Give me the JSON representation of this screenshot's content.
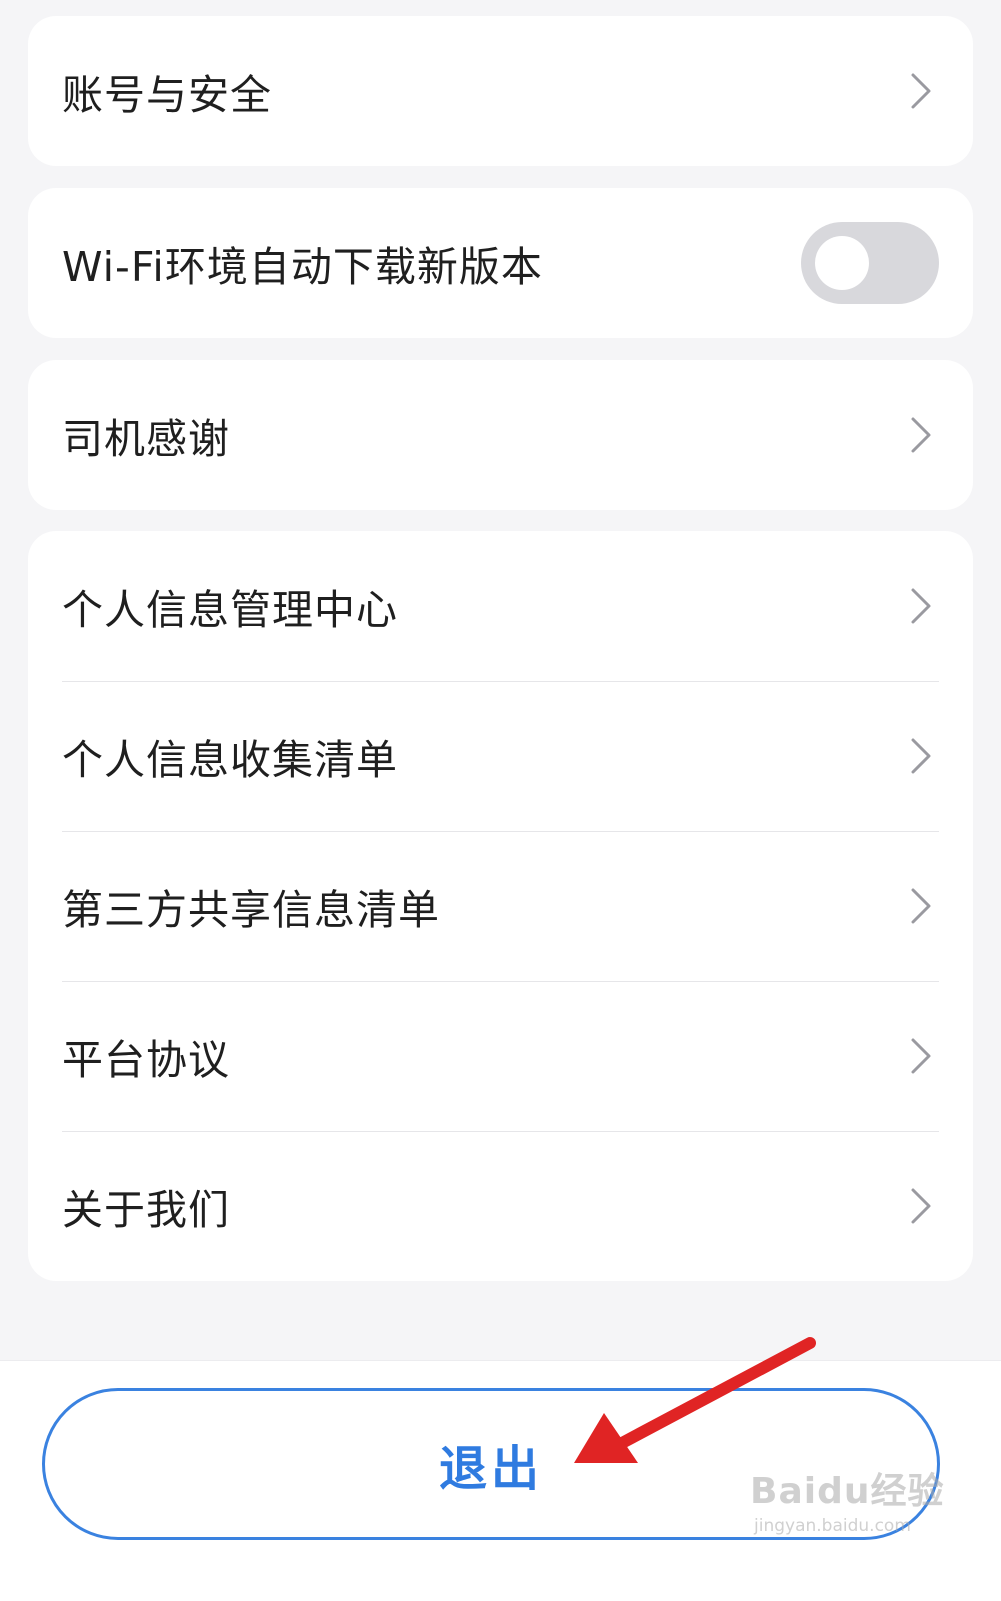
{
  "settings": {
    "group1": [
      {
        "label": "账号与安全",
        "icon": "chevron-right-icon"
      }
    ],
    "group2": [
      {
        "label": "Wi-Fi环境自动下载新版本",
        "toggle_on": false
      }
    ],
    "group3": [
      {
        "label": "司机感谢",
        "icon": "chevron-right-icon"
      }
    ],
    "group4": [
      {
        "label": "个人信息管理中心",
        "icon": "chevron-right-icon"
      },
      {
        "label": "个人信息收集清单",
        "icon": "chevron-right-icon"
      },
      {
        "label": "第三方共享信息清单",
        "icon": "chevron-right-icon"
      },
      {
        "label": "平台协议",
        "icon": "chevron-right-icon"
      },
      {
        "label": "关于我们",
        "icon": "chevron-right-icon"
      }
    ]
  },
  "logout": {
    "label": "退出"
  },
  "watermark": {
    "brand": "Baidu经验",
    "url": "jingyan.baidu.com"
  },
  "colors": {
    "accent": "#2f7be0",
    "annotation_arrow": "#e02424",
    "toggle_off": "#d8d8dc"
  }
}
